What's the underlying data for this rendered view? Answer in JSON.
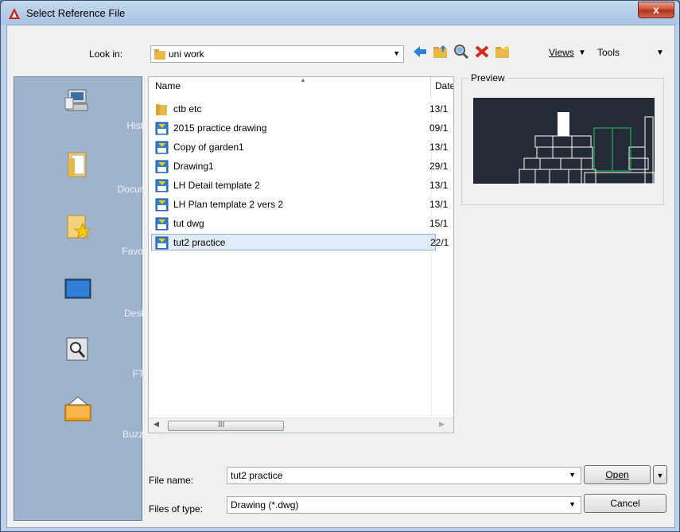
{
  "window": {
    "title": "Select Reference File",
    "close_label": "x"
  },
  "toolbar": {
    "look_in_label": "Look in:",
    "look_in_value": "uni work",
    "views_label": "Views",
    "tools_label": "Tools"
  },
  "places": [
    {
      "label": "History"
    },
    {
      "label": "Documents"
    },
    {
      "label": "Favorites"
    },
    {
      "label": "Desktop"
    },
    {
      "label": "FTP"
    },
    {
      "label": "Buzzsaw"
    }
  ],
  "file_list": {
    "columns": [
      "Name",
      "Date"
    ],
    "rows": [
      {
        "name": "ctb etc",
        "date": "13/1",
        "type": "folder"
      },
      {
        "name": "2015 practice drawing",
        "date": "09/1",
        "type": "dwg"
      },
      {
        "name": "Copy of garden1",
        "date": "13/1",
        "type": "dwg"
      },
      {
        "name": "Drawing1",
        "date": "29/1",
        "type": "dwg"
      },
      {
        "name": "LH Detail  template 2",
        "date": "13/1",
        "type": "dwg"
      },
      {
        "name": "LH Plan template 2 vers 2",
        "date": "13/1",
        "type": "dwg"
      },
      {
        "name": "tut dwg",
        "date": "15/1",
        "type": "dwg"
      },
      {
        "name": "tut2 practice",
        "date": "22/1",
        "type": "dwg",
        "selected": true
      }
    ],
    "scroll_grip": "III"
  },
  "preview": {
    "label": "Preview"
  },
  "bottom": {
    "file_name_label": "File name:",
    "file_name_value": "tut2 practice",
    "files_of_type_label": "Files of type:",
    "files_of_type_value": "Drawing (*.dwg)",
    "open_label": "Open",
    "cancel_label": "Cancel"
  },
  "colors": {
    "accent": "#3a6ea5",
    "places_bg": "#9fb3cd",
    "selection": "#e1ebf8"
  }
}
